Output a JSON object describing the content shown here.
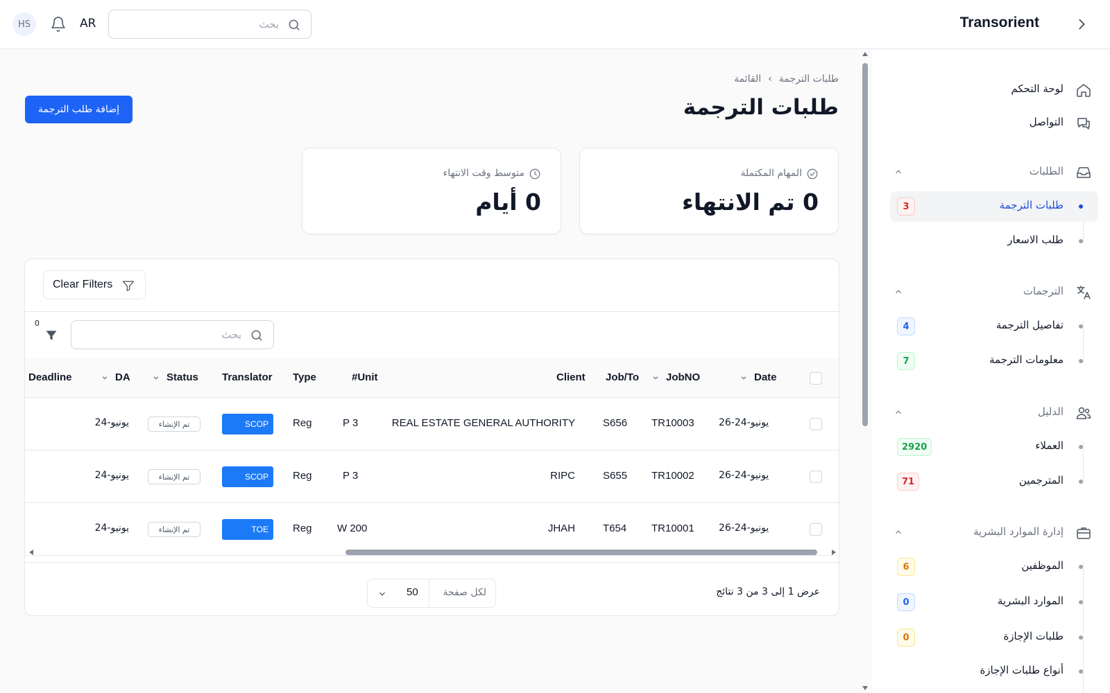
{
  "header": {
    "brand": "Transorient",
    "user_initials": "HS",
    "language": "AR",
    "search_placeholder": "بحث"
  },
  "sidebar": {
    "top_items": [
      {
        "label": "لوحة التحكم",
        "icon": "home-icon"
      },
      {
        "label": "التواصل",
        "icon": "chat-icon"
      }
    ],
    "groups": [
      {
        "label": "الطلبات",
        "icon": "inbox-icon",
        "items": [
          {
            "label": "طلبات الترجمة",
            "badge": "3",
            "active": true
          },
          {
            "label": "طلب الاسعار",
            "badge": ""
          }
        ]
      },
      {
        "label": "الترجمات",
        "icon": "translate-icon",
        "items": [
          {
            "label": "تفاصيل الترجمة",
            "badge": "4"
          },
          {
            "label": "معلومات الترجمة",
            "badge": "7"
          }
        ]
      },
      {
        "label": "الدليل",
        "icon": "users-icon",
        "items": [
          {
            "label": "العملاء",
            "badge": "2920"
          },
          {
            "label": "المترجمين",
            "badge": "71"
          }
        ]
      },
      {
        "label": "إدارة الموارد البشرية",
        "icon": "briefcase-icon",
        "items": [
          {
            "label": "الموظفين",
            "badge": "6"
          },
          {
            "label": "الموارد البشرية",
            "badge": "0"
          },
          {
            "label": "طلبات الإجازة",
            "badge": "0"
          },
          {
            "label": "أنواع طلبات الإجازة",
            "badge": ""
          }
        ]
      }
    ]
  },
  "page": {
    "breadcrumb": [
      "طلبات الترجمة",
      "القائمة"
    ],
    "title": "طلبات الترجمة",
    "add_button": "إضافة طلب الترجمة"
  },
  "stats": [
    {
      "label": "المهام المكتملة",
      "value": "0 تم الانتهاء",
      "icon": "check-circle-icon"
    },
    {
      "label": "متوسط وقت الانتهاء",
      "value": "0 أيام",
      "icon": "clock-icon"
    }
  ],
  "table": {
    "clear_filters": "Clear Filters",
    "search_placeholder": "بحث",
    "filter_count": "0",
    "columns": {
      "date": "Date",
      "jobno": "JobNO",
      "jobto": "Job/To",
      "client": "Client",
      "unit": "#Unit",
      "type": "Type",
      "translator": "Translator",
      "status": "Status",
      "da": "DA",
      "deadline": "Deadline"
    },
    "rows": [
      {
        "date": "26-يونيو-24",
        "jobno": "TR10003",
        "jobto": "S656",
        "client": "REAL ESTATE GENERAL AUTHORITY",
        "unit": "P 3",
        "type": "Reg",
        "translator": "SCOP",
        "status": "تم الإنشاء",
        "da": "24-يونيو",
        "deadline": ""
      },
      {
        "date": "26-يونيو-24",
        "jobno": "TR10002",
        "jobto": "S655",
        "client": "RIPC",
        "unit": "P 3",
        "type": "Reg",
        "translator": "SCOP",
        "status": "تم الإنشاء",
        "da": "24-يونيو",
        "deadline": ""
      },
      {
        "date": "26-يونيو-24",
        "jobno": "TR10001",
        "jobto": "T654",
        "client": "JHAH",
        "unit": "W 200",
        "type": "Reg",
        "translator": "TOE",
        "status": "تم الإنشاء",
        "da": "24-يونيو",
        "deadline": ""
      }
    ],
    "per_page_label": "لكل صفحة",
    "per_page_value": "50",
    "results_text": "عرض 1 إلى 3 من 3 نتائج"
  },
  "colors": {
    "primary": "#1d63f5",
    "translator_badge": "#1d7af7",
    "active_link": "#1d4ed8"
  }
}
